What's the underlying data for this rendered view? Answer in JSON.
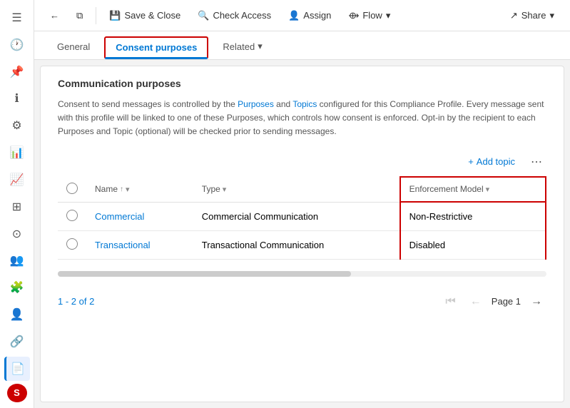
{
  "sidebar": {
    "items": [
      {
        "name": "hamburger",
        "icon": "☰",
        "active": false
      },
      {
        "name": "clock",
        "icon": "🕐",
        "active": false
      },
      {
        "name": "pin",
        "icon": "📌",
        "active": false
      },
      {
        "name": "info",
        "icon": "ℹ",
        "active": false
      },
      {
        "name": "settings",
        "icon": "⚙",
        "active": false
      },
      {
        "name": "chart",
        "icon": "📊",
        "active": false
      },
      {
        "name": "trend",
        "icon": "📈",
        "active": false
      },
      {
        "name": "grid",
        "icon": "⊞",
        "active": false
      },
      {
        "name": "toggle",
        "icon": "⊙",
        "active": false
      },
      {
        "name": "people",
        "icon": "👥",
        "active": false
      },
      {
        "name": "puzzle",
        "icon": "🧩",
        "active": false
      },
      {
        "name": "person-add",
        "icon": "👤",
        "active": false
      },
      {
        "name": "link",
        "icon": "🔗",
        "active": false
      },
      {
        "name": "doc-active",
        "icon": "📄",
        "active": true
      }
    ],
    "avatar": "S"
  },
  "toolbar": {
    "back_icon": "←",
    "window_icon": "⧉",
    "save_close_label": "Save & Close",
    "check_access_icon": "🔍",
    "check_access_label": "Check Access",
    "assign_icon": "👤",
    "assign_label": "Assign",
    "flow_icon": "⟴",
    "flow_label": "Flow",
    "flow_dropdown_icon": "▾",
    "share_icon": "↗",
    "share_label": "Share",
    "share_dropdown_icon": "▾"
  },
  "tabs": [
    {
      "label": "General",
      "active": false
    },
    {
      "label": "Consent purposes",
      "active": true
    },
    {
      "label": "Related",
      "active": false,
      "has_arrow": true
    }
  ],
  "content": {
    "section_title": "Communication purposes",
    "info_text": "Consent to send messages is controlled by the Purposes and Topics configured for this Compliance Profile. Every message sent with this profile will be linked to one of these Purposes, which controls how consent is enforced. Opt-in by the recipient to each Purposes and Topic (optional) will be checked prior to sending messages.",
    "add_topic_label": "Add topic",
    "add_topic_icon": "+",
    "more_icon": "⋯",
    "table": {
      "columns": [
        {
          "key": "name",
          "label": "Name",
          "sort": "↑",
          "has_filter": true
        },
        {
          "key": "type",
          "label": "Type",
          "has_filter": true
        },
        {
          "key": "enforcement",
          "label": "Enforcement Model",
          "has_filter": true,
          "highlighted": true
        }
      ],
      "rows": [
        {
          "name": "Commercial",
          "type": "Commercial Communication",
          "enforcement": "Non-Restrictive"
        },
        {
          "name": "Transactional",
          "type": "Transactional Communication",
          "enforcement": "Disabled"
        }
      ]
    },
    "pagination": {
      "range_label": "1 - 2 of 2",
      "first_icon": "⏮",
      "prev_icon": "←",
      "page_label": "Page 1",
      "next_icon": "→"
    }
  }
}
